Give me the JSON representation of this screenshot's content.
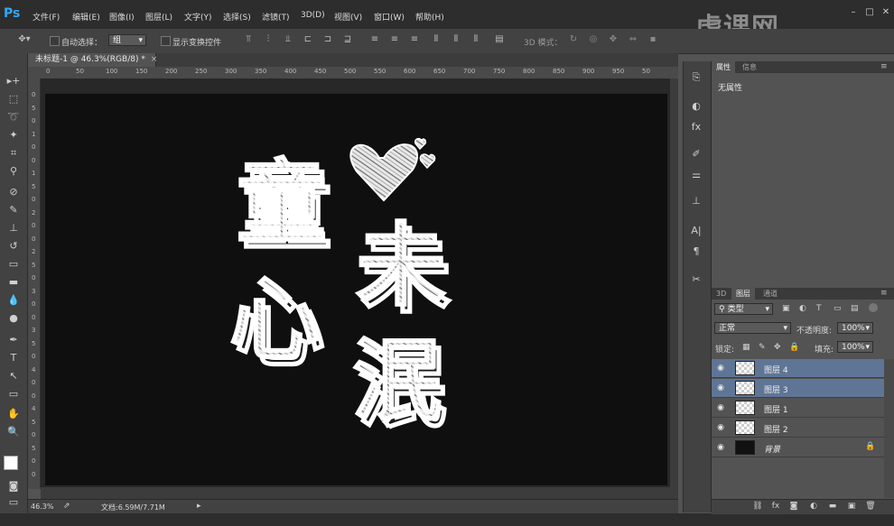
{
  "app": {
    "logo": "Ps",
    "watermark": "虎课网"
  },
  "menu": [
    "文件(F)",
    "编辑(E)",
    "图像(I)",
    "图层(L)",
    "文字(Y)",
    "选择(S)",
    "滤镜(T)",
    "3D(D)",
    "视图(V)",
    "窗口(W)",
    "帮助(H)"
  ],
  "options": {
    "auto_select_label": "自动选择：",
    "auto_select_value": "组",
    "show_transform_label": "显示变换控件",
    "mode_3d_label": "3D 模式："
  },
  "document": {
    "tab_title": "未标题-1 @ 46.3%(RGB/8) *",
    "zoom": "46.3%",
    "doc_size": "文档:6.59M/7.71M",
    "ruler_h": [
      "0",
      "50",
      "100",
      "150",
      "200",
      "250",
      "300",
      "350",
      "400",
      "450",
      "500",
      "550",
      "600",
      "650",
      "700",
      "750",
      "800",
      "850",
      "900",
      "950",
      "50"
    ],
    "ruler_v": [
      "0",
      "5",
      "0",
      "1",
      "0",
      "0",
      "1",
      "5",
      "0",
      "2",
      "0",
      "0",
      "2",
      "5",
      "0",
      "3",
      "0",
      "0",
      "3",
      "5",
      "0",
      "4",
      "0",
      "0",
      "4",
      "5",
      "0",
      "5",
      "0",
      "0"
    ]
  },
  "artwork": {
    "line1": "童",
    "line2": "心",
    "line3": "未",
    "line4": "泯"
  },
  "properties": {
    "tabs": [
      "属性",
      "信息"
    ],
    "content": "无属性"
  },
  "layers": {
    "tabs": [
      "3D",
      "图层",
      "通道"
    ],
    "filter_label": "类型",
    "blend_mode": "正常",
    "opacity_label": "不透明度:",
    "opacity_value": "100%",
    "lock_label": "锁定:",
    "fill_label": "填充:",
    "fill_value": "100%",
    "items": [
      {
        "name": "图层 4",
        "selected": true
      },
      {
        "name": "图层 3",
        "selected": true
      },
      {
        "name": "图层 1",
        "selected": false
      },
      {
        "name": "图层 2",
        "selected": false
      },
      {
        "name": "背景",
        "selected": false,
        "locked": true
      }
    ]
  }
}
